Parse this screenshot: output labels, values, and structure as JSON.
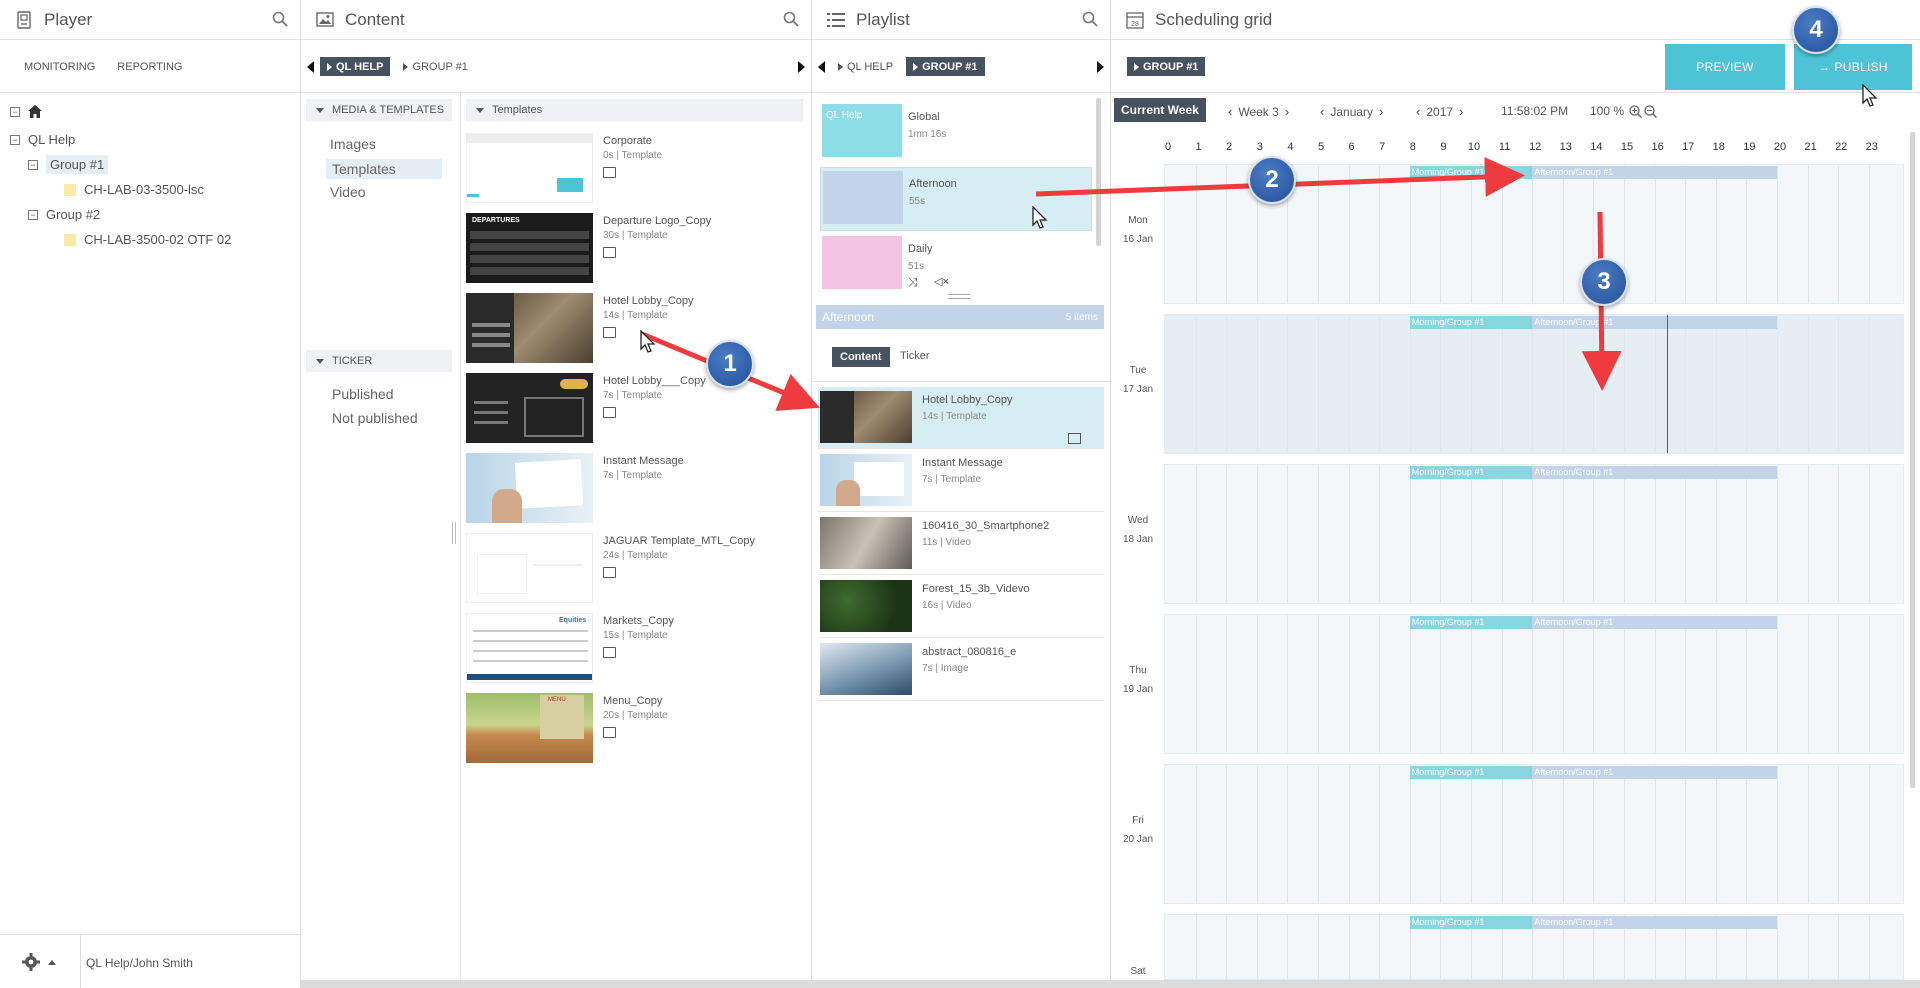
{
  "player": {
    "title": "Player",
    "tabs": [
      "MONITORING",
      "REPORTING"
    ],
    "tree": {
      "root": "QL Help",
      "group1": "Group #1",
      "device1": "CH-LAB-03-3500-lsc",
      "group2": "Group #2",
      "device2": "CH-LAB-3500-02 OTF 02"
    },
    "user": "QL Help/John Smith"
  },
  "content": {
    "title": "Content",
    "crumbs": [
      "QL HELP",
      "GROUP #1"
    ],
    "media_section": "MEDIA & TEMPLATES",
    "media_links": [
      "Images",
      "Templates",
      "Video"
    ],
    "ticker_section": "TICKER",
    "ticker_links": [
      "Published",
      "Not published"
    ],
    "templates_header": "Templates",
    "templates": [
      {
        "name": "Corporate",
        "dur": "0s",
        "type": "Template"
      },
      {
        "name": "Departure Logo_Copy",
        "dur": "30s",
        "type": "Template"
      },
      {
        "name": "Hotel Lobby_Copy",
        "dur": "14s",
        "type": "Template"
      },
      {
        "name": "Hotel Lobby___Copy",
        "dur": "7s",
        "type": "Template"
      },
      {
        "name": "Instant Message",
        "dur": "7s",
        "type": "Template"
      },
      {
        "name": "JAGUAR Template_MTL_Copy",
        "dur": "24s",
        "type": "Template"
      },
      {
        "name": "Markets_Copy",
        "dur": "15s",
        "type": "Template"
      },
      {
        "name": "Menu_Copy",
        "dur": "20s",
        "type": "Template"
      }
    ],
    "thumb_text": {
      "departures": "DEPARTURES",
      "equities": "Equities",
      "menu": "MENU"
    }
  },
  "playlist": {
    "title": "Playlist",
    "crumbs": [
      "QL HELP",
      "GROUP #1"
    ],
    "items": [
      {
        "name": "Global",
        "dur": "1mn 16s",
        "swatch": "QL Help"
      },
      {
        "name": "Afternoon",
        "dur": "55s"
      },
      {
        "name": "Daily",
        "dur": "51s"
      }
    ],
    "selected_name": "Afternoon",
    "selected_count": "5 items",
    "tabs": [
      "Content",
      "Ticker"
    ],
    "contents": [
      {
        "name": "Hotel Lobby_Copy",
        "dur": "14s",
        "type": "Template"
      },
      {
        "name": "Instant Message",
        "dur": "7s",
        "type": "Template"
      },
      {
        "name": "160416_30_Smartphone2",
        "dur": "11s",
        "type": "Video"
      },
      {
        "name": "Forest_15_3b_Videvo",
        "dur": "16s",
        "type": "Video"
      },
      {
        "name": "abstract_080816_e",
        "dur": "7s",
        "type": "Image"
      }
    ]
  },
  "grid": {
    "title": "Scheduling grid",
    "icon_day": "28",
    "crumb": "GROUP #1",
    "preview": "PREVIEW",
    "publish": "PUBLISH",
    "current_week": "Current Week",
    "week": "Week 3",
    "month": "January",
    "year": "2017",
    "time": "11:58:02 PM",
    "zoom": "100 %",
    "hours": [
      "0",
      "1",
      "2",
      "3",
      "4",
      "5",
      "6",
      "7",
      "8",
      "9",
      "10",
      "11",
      "12",
      "13",
      "14",
      "15",
      "16",
      "17",
      "18",
      "19",
      "20",
      "21",
      "22",
      "23"
    ],
    "days": [
      {
        "dow": "Mon",
        "date": "16 Jan"
      },
      {
        "dow": "Tue",
        "date": "17 Jan"
      },
      {
        "dow": "Wed",
        "date": "18 Jan"
      },
      {
        "dow": "Thu",
        "date": "19 Jan"
      },
      {
        "dow": "Fri",
        "date": "20 Jan"
      },
      {
        "dow": "Sat",
        "date": ""
      }
    ],
    "morning_label": "Morning/Group #1",
    "afternoon_label": "Afternoon/Group #1"
  },
  "callouts": [
    "1",
    "2",
    "3",
    "4"
  ],
  "colors": {
    "accent": "#4dc3d6",
    "dark": "#46525f",
    "morning": "#87d6e0",
    "afternoon": "#c2d3ea",
    "arrow": "#ef3b3e",
    "badge": "#2e5fa8"
  }
}
